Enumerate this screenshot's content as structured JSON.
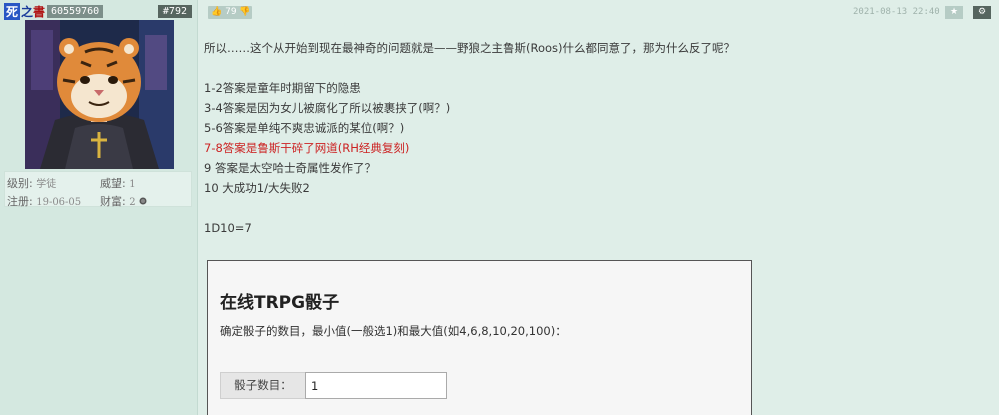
{
  "user": {
    "name_box": "死",
    "name_rest": "之",
    "name_tail": "書",
    "uid": "60559760",
    "floor": "#792",
    "stats": {
      "level_label": "级别:",
      "level_value": "学徒",
      "prestige_label": "威望:",
      "prestige_value": "1",
      "reg_label": "注册:",
      "reg_value": "19-06-05",
      "wealth_label": "财富:",
      "wealth_value": "2"
    }
  },
  "post": {
    "likes": "79",
    "timestamp": "2021-08-13 22:40",
    "star_icon": "★",
    "gear_icon": "⚙",
    "lines": [
      "所以……这个从开始到现在最神奇的问题就是——野狼之主鲁斯(Roos)什么都同意了，那为什么反了呢？",
      "",
      "1-2答案是童年时期留下的隐患",
      "3-4答案是因为女儿被腐化了所以被裹挟了(啊？)",
      "5-6答案是单纯不爽忠诚派的某位(啊？)",
      "7-8答案是鲁斯干碎了网道(RH经典复刻)",
      "9 答案是太空哈士奇属性发作了？",
      "10 大成功1/大失败2",
      "",
      "1D10=7"
    ],
    "embed": {
      "title": "在线TRPG骰子",
      "desc": "确定骰子的数目，最小值(一般选1)和最大值(如4,6,8,10,20,100)：",
      "dice_label": "骰子数目：",
      "dice_value": "1"
    }
  },
  "colors": {
    "background": "#dfeee8",
    "highlight_line": "#cc2222",
    "username": "#2856c4"
  }
}
